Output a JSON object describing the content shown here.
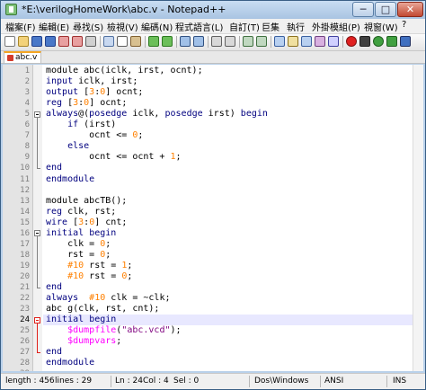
{
  "window": {
    "title": "*E:\\verilogHomeWork\\abc.v - Notepad++",
    "controls": {
      "minimize": "─",
      "maximize": "□",
      "close": "✕"
    }
  },
  "menu": [
    "檔案(F)",
    "編輯(E)",
    "尋找(S)",
    "檢視(V)",
    "編碼(N)",
    "程式語言(L)",
    "自訂(T)",
    "巨集",
    "執行",
    "外掛模組(P)",
    "視窗(W)",
    "?"
  ],
  "toolbar": {
    "icons": [
      "new-file-icon",
      "open-file-icon",
      "save-icon",
      "save-all-icon",
      "close-icon",
      "close-all-icon",
      "print-icon",
      "cut-icon",
      "copy-icon",
      "paste-icon",
      "undo-icon",
      "redo-icon",
      "find-icon",
      "replace-icon",
      "zoom-in-icon",
      "zoom-out-icon",
      "sync-v-icon",
      "sync-h-icon",
      "word-wrap-icon",
      "show-all-chars-icon",
      "indent-guide-icon",
      "user-lang-icon",
      "doc-map-icon",
      "record-macro-icon",
      "stop-macro-icon",
      "play-macro-icon",
      "run-macro-multiple-icon",
      "save-macro-icon"
    ]
  },
  "tab": {
    "label": "abc.v",
    "icon": "unsaved-file-icon"
  },
  "editor": {
    "current_line": 24,
    "lines": [
      [
        [
          "module abc(iclk, irst, ocnt);",
          "o"
        ]
      ],
      [
        [
          "input",
          "k"
        ],
        [
          " iclk, irst;",
          "o"
        ]
      ],
      [
        [
          "output",
          "k"
        ],
        [
          " [",
          "o"
        ],
        [
          "3",
          "n"
        ],
        [
          ":",
          "o"
        ],
        [
          "0",
          "n"
        ],
        [
          "] ocnt;",
          "o"
        ]
      ],
      [
        [
          "reg",
          "k"
        ],
        [
          " [",
          "o"
        ],
        [
          "3",
          "n"
        ],
        [
          ":",
          "o"
        ],
        [
          "0",
          "n"
        ],
        [
          "] ocnt;",
          "o"
        ]
      ],
      [
        [
          "always",
          "k"
        ],
        [
          "@(",
          "o"
        ],
        [
          "posedge",
          "k"
        ],
        [
          " iclk, ",
          "o"
        ],
        [
          "posedge",
          "k"
        ],
        [
          " irst) ",
          "o"
        ],
        [
          "begin",
          "k"
        ]
      ],
      [
        [
          "    ",
          "o"
        ],
        [
          "if",
          "k"
        ],
        [
          " (irst)",
          "o"
        ]
      ],
      [
        [
          "        ocnt <= ",
          "o"
        ],
        [
          "0",
          "n"
        ],
        [
          ";",
          "o"
        ]
      ],
      [
        [
          "    ",
          "o"
        ],
        [
          "else",
          "k"
        ]
      ],
      [
        [
          "        ocnt <= ocnt + ",
          "o"
        ],
        [
          "1",
          "n"
        ],
        [
          ";",
          "o"
        ]
      ],
      [
        [
          "end",
          "k"
        ]
      ],
      [
        [
          "endmodule",
          "k"
        ]
      ],
      [
        [
          "",
          "o"
        ]
      ],
      [
        [
          "module abcTB();",
          "o"
        ]
      ],
      [
        [
          "reg",
          "k"
        ],
        [
          " clk, rst;",
          "o"
        ]
      ],
      [
        [
          "wire",
          "k"
        ],
        [
          " [",
          "o"
        ],
        [
          "3",
          "n"
        ],
        [
          ":",
          "o"
        ],
        [
          "0",
          "n"
        ],
        [
          "] cnt;",
          "o"
        ]
      ],
      [
        [
          "initial",
          "k"
        ],
        [
          " ",
          "o"
        ],
        [
          "begin",
          "k"
        ]
      ],
      [
        [
          "    clk = ",
          "o"
        ],
        [
          "0",
          "n"
        ],
        [
          ";",
          "o"
        ]
      ],
      [
        [
          "    rst = ",
          "o"
        ],
        [
          "0",
          "n"
        ],
        [
          ";",
          "o"
        ]
      ],
      [
        [
          "    ",
          "o"
        ],
        [
          "#10",
          "n"
        ],
        [
          " rst = ",
          "o"
        ],
        [
          "1",
          "n"
        ],
        [
          ";",
          "o"
        ]
      ],
      [
        [
          "    ",
          "o"
        ],
        [
          "#10",
          "n"
        ],
        [
          " rst = ",
          "o"
        ],
        [
          "0",
          "n"
        ],
        [
          ";",
          "o"
        ]
      ],
      [
        [
          "end",
          "k"
        ]
      ],
      [
        [
          "always",
          "k"
        ],
        [
          "  ",
          "o"
        ],
        [
          "#10",
          "n"
        ],
        [
          " clk = ~clk;",
          "o"
        ]
      ],
      [
        [
          "abc g(clk, rst, cnt);",
          "o"
        ]
      ],
      [
        [
          "initial",
          "k"
        ],
        [
          " ",
          "o"
        ],
        [
          "begin",
          "k"
        ]
      ],
      [
        [
          "    ",
          "o"
        ],
        [
          "$dumpfile",
          "f"
        ],
        [
          "(",
          "o"
        ],
        [
          "\"abc.vcd\"",
          "s"
        ],
        [
          ");",
          "o"
        ]
      ],
      [
        [
          "    ",
          "o"
        ],
        [
          "$dumpvars",
          "f"
        ],
        [
          ";",
          "o"
        ]
      ],
      [
        [
          "end",
          "k"
        ]
      ],
      [
        [
          "endmodule",
          "k"
        ]
      ],
      [
        [
          "",
          "o"
        ]
      ]
    ]
  },
  "status": {
    "length": "length : 456",
    "lines": "lines : 29",
    "position": "Ln : 24",
    "column": "Col : 4",
    "selection": "Sel : 0",
    "eol": "Dos\\Windows",
    "encoding": "ANSI",
    "mode": "INS"
  }
}
